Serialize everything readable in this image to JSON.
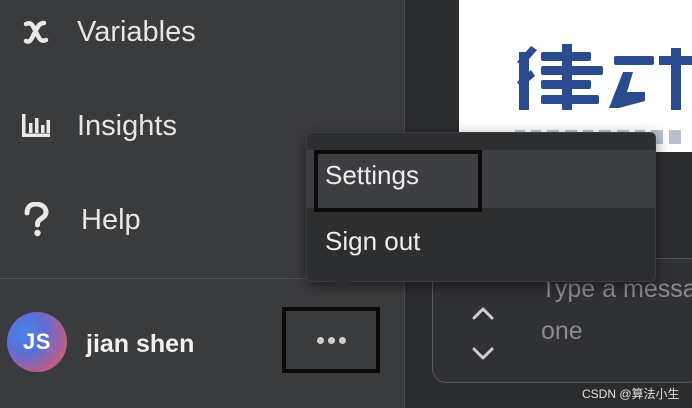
{
  "sidebar": {
    "items": [
      {
        "label": "Variables",
        "icon": "variable-x-icon"
      },
      {
        "label": "Insights",
        "icon": "bar-chart-icon"
      },
      {
        "label": "Help",
        "icon": "question-mark-icon"
      }
    ]
  },
  "user": {
    "initials": "JS",
    "name": "jian shen"
  },
  "menu": {
    "items": [
      {
        "label": "Settings"
      },
      {
        "label": "Sign out"
      }
    ]
  },
  "composer": {
    "placeholder": "Type a message or\none"
  },
  "watermark": {
    "text": "CSDN @算法小生"
  },
  "colors": {
    "sidebar_bg": "#3a3b3d",
    "menu_bg": "#2d2e30",
    "menu_hover": "#3d3e41",
    "logo_blue": "#2a4b8d"
  }
}
